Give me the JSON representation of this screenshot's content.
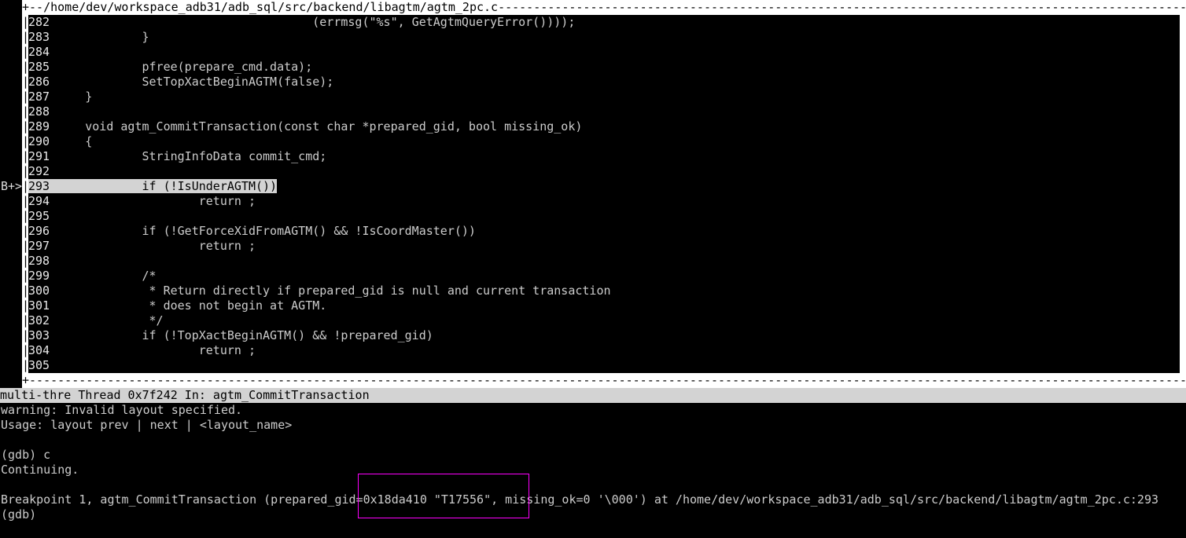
{
  "source_window": {
    "title": "+--/home/dev/workspace_adb31/adb_sql/src/backend/libagtm/agtm_2pc.c",
    "breakpoint_marker": "B+>",
    "current_line": 293,
    "lines": [
      {
        "num": "282",
        "code": "                                     (errmsg(\"%s\", GetAgtmQueryError())));"
      },
      {
        "num": "283",
        "code": "             }"
      },
      {
        "num": "284",
        "code": ""
      },
      {
        "num": "285",
        "code": "             pfree(prepare_cmd.data);"
      },
      {
        "num": "286",
        "code": "             SetTopXactBeginAGTM(false);"
      },
      {
        "num": "287",
        "code": "     }"
      },
      {
        "num": "288",
        "code": ""
      },
      {
        "num": "289",
        "code": "     void agtm_CommitTransaction(const char *prepared_gid, bool missing_ok)"
      },
      {
        "num": "290",
        "code": "     {"
      },
      {
        "num": "291",
        "code": "             StringInfoData commit_cmd;"
      },
      {
        "num": "292",
        "code": ""
      },
      {
        "num": "293",
        "code": "             if (!IsUnderAGTM())"
      },
      {
        "num": "294",
        "code": "                     return ;"
      },
      {
        "num": "295",
        "code": ""
      },
      {
        "num": "296",
        "code": "             if (!GetForceXidFromAGTM() && !IsCoordMaster())"
      },
      {
        "num": "297",
        "code": "                     return ;"
      },
      {
        "num": "298",
        "code": ""
      },
      {
        "num": "299",
        "code": "             /*"
      },
      {
        "num": "300",
        "code": "              * Return directly if prepared_gid is null and current transaction"
      },
      {
        "num": "301",
        "code": "              * does not begin at AGTM."
      },
      {
        "num": "302",
        "code": "              */"
      },
      {
        "num": "303",
        "code": "             if (!TopXactBeginAGTM() && !prepared_gid)"
      },
      {
        "num": "304",
        "code": "                     return ;"
      },
      {
        "num": "305",
        "code": ""
      }
    ]
  },
  "status_bar": "multi-thre Thread 0x7f242 In: agtm_CommitTransaction",
  "command_output": [
    "warning: Invalid layout specified.",
    "Usage: layout prev | next | <layout_name>",
    "",
    "(gdb) c",
    "Continuing.",
    "",
    "Breakpoint 1, agtm_CommitTransaction (prepared_gid=0x18da410 \"T17556\", missing_ok=0 '\\000') at /home/dev/workspace_adb31/adb_sql/src/backend/libagtm/agtm_2pc.c:293",
    "(gdb)"
  ],
  "colors": {
    "selection_box": "#ff00ff",
    "highlight": "#d3d3d3",
    "status_bar": "#d3d3d3"
  }
}
